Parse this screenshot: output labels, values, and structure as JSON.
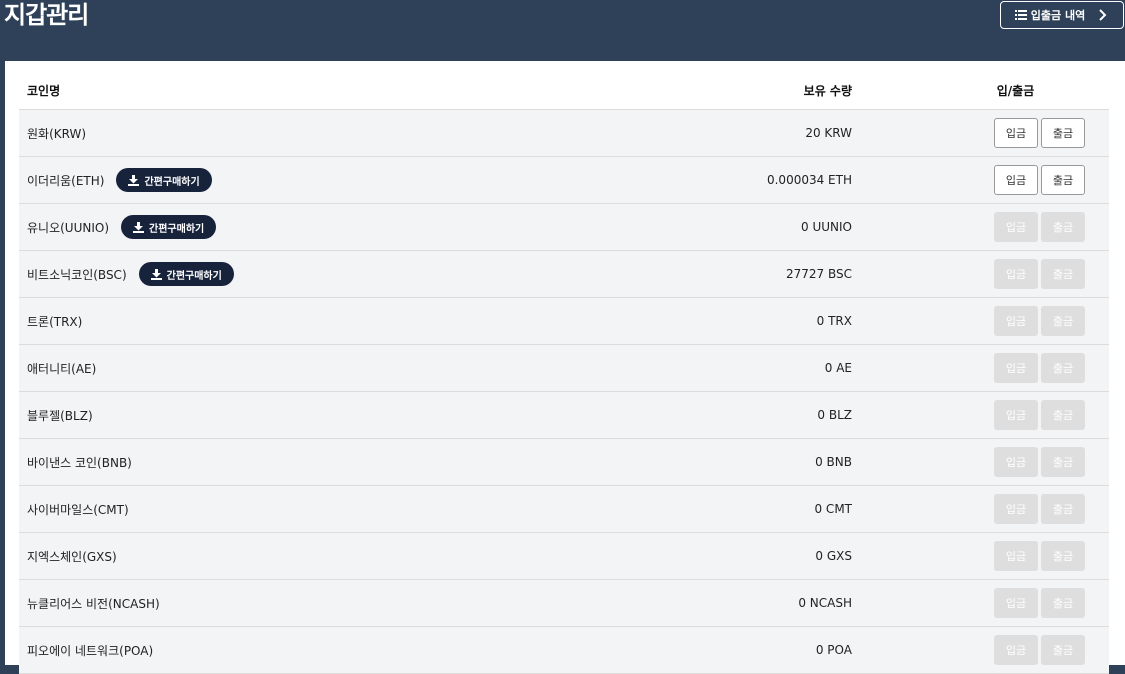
{
  "header": {
    "title": "지갑관리",
    "history_label": "입출금 내역"
  },
  "table": {
    "headers": {
      "name": "코인명",
      "qty": "보유 수량",
      "actions": "입/출금"
    },
    "quick_buy_label": "간편구매하기",
    "deposit_label": "입금",
    "withdraw_label": "출금",
    "rows": [
      {
        "name": "원화(KRW)",
        "qty": "20 KRW",
        "quick_buy": false,
        "enabled": true
      },
      {
        "name": "이더리움(ETH)",
        "qty": "0.000034 ETH",
        "quick_buy": true,
        "enabled": true
      },
      {
        "name": "유니오(UUNIO)",
        "qty": "0 UUNIO",
        "quick_buy": true,
        "enabled": false
      },
      {
        "name": "비트소닉코인(BSC)",
        "qty": "27727 BSC",
        "quick_buy": true,
        "enabled": false
      },
      {
        "name": "트론(TRX)",
        "qty": "0 TRX",
        "quick_buy": false,
        "enabled": false
      },
      {
        "name": "애터니티(AE)",
        "qty": "0 AE",
        "quick_buy": false,
        "enabled": false
      },
      {
        "name": "블루젤(BLZ)",
        "qty": "0 BLZ",
        "quick_buy": false,
        "enabled": false
      },
      {
        "name": "바이낸스 코인(BNB)",
        "qty": "0 BNB",
        "quick_buy": false,
        "enabled": false
      },
      {
        "name": "사이버마일스(CMT)",
        "qty": "0 CMT",
        "quick_buy": false,
        "enabled": false
      },
      {
        "name": "지엑스체인(GXS)",
        "qty": "0 GXS",
        "quick_buy": false,
        "enabled": false
      },
      {
        "name": "뉴클리어스 비전(NCASH)",
        "qty": "0 NCASH",
        "quick_buy": false,
        "enabled": false
      },
      {
        "name": "피오에이 네트워크(POA)",
        "qty": "0 POA",
        "quick_buy": false,
        "enabled": false
      }
    ]
  },
  "colors": {
    "header_bg": "#2e4159",
    "quick_btn_bg": "#17223b",
    "row_bg": "#f3f4f6",
    "disabled_btn": "#dedede"
  }
}
